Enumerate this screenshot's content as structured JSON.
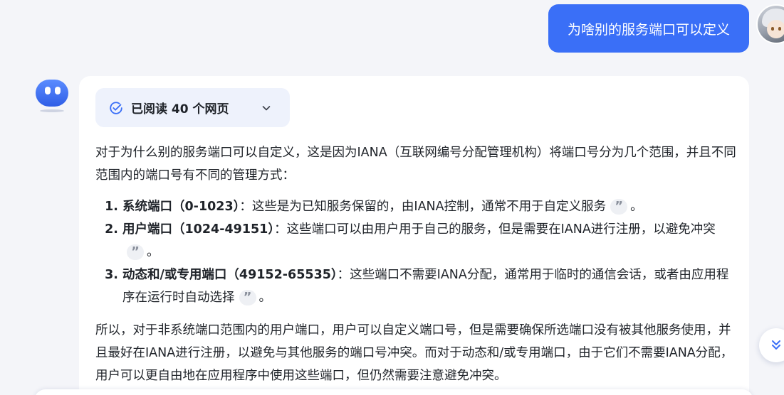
{
  "user_message": {
    "text": "为啥别的服务端口可以定义"
  },
  "answer": {
    "sources_label": "已阅读 40 个网页",
    "intro": "对于为什么别的服务端口可以自定义，这是因为IANA（互联网编号分配管理机构）将端口号分为几个范围，并且不同范围内的端口号有不同的管理方式：",
    "items": [
      {
        "title": "系统端口（0-1023）",
        "text": "：这些是为已知服务保留的，由IANA控制，通常不用于自定义服务",
        "end": "。"
      },
      {
        "title": "用户端口（1024-49151）",
        "text": "：这些端口可以由用户用于自己的服务，但是需要在IANA进行注册，以避免冲突",
        "end": "。"
      },
      {
        "title": "动态和/或专用端口（49152-65535）",
        "text": "：这些端口不需要IANA分配，通常用于临时的通信会话，或者由应用程序在运行时自动选择",
        "end": "。"
      }
    ],
    "conclusion": "所以，对于非系统端口范围内的用户端口，用户可以自定义端口号，但是需要确保所选端口没有被其他服务使用，并且最好在IANA进行注册，以避免与其他服务的端口号冲突。而对于动态和/或专用端口，由于它们不需要IANA分配，用户可以更自由地在应用程序中使用这些端口，但仍然需要注意避免冲突。",
    "quote_glyph": "”"
  },
  "colors": {
    "accent": "#3a6ff7",
    "chip_bg": "#eef2fc",
    "page_bg": "#f4f5f9"
  },
  "icons": {
    "sources": "check-circle-icon",
    "expand": "chevron-down-icon",
    "scroll": "double-chevron-down-icon",
    "citation": "quote-icon"
  }
}
